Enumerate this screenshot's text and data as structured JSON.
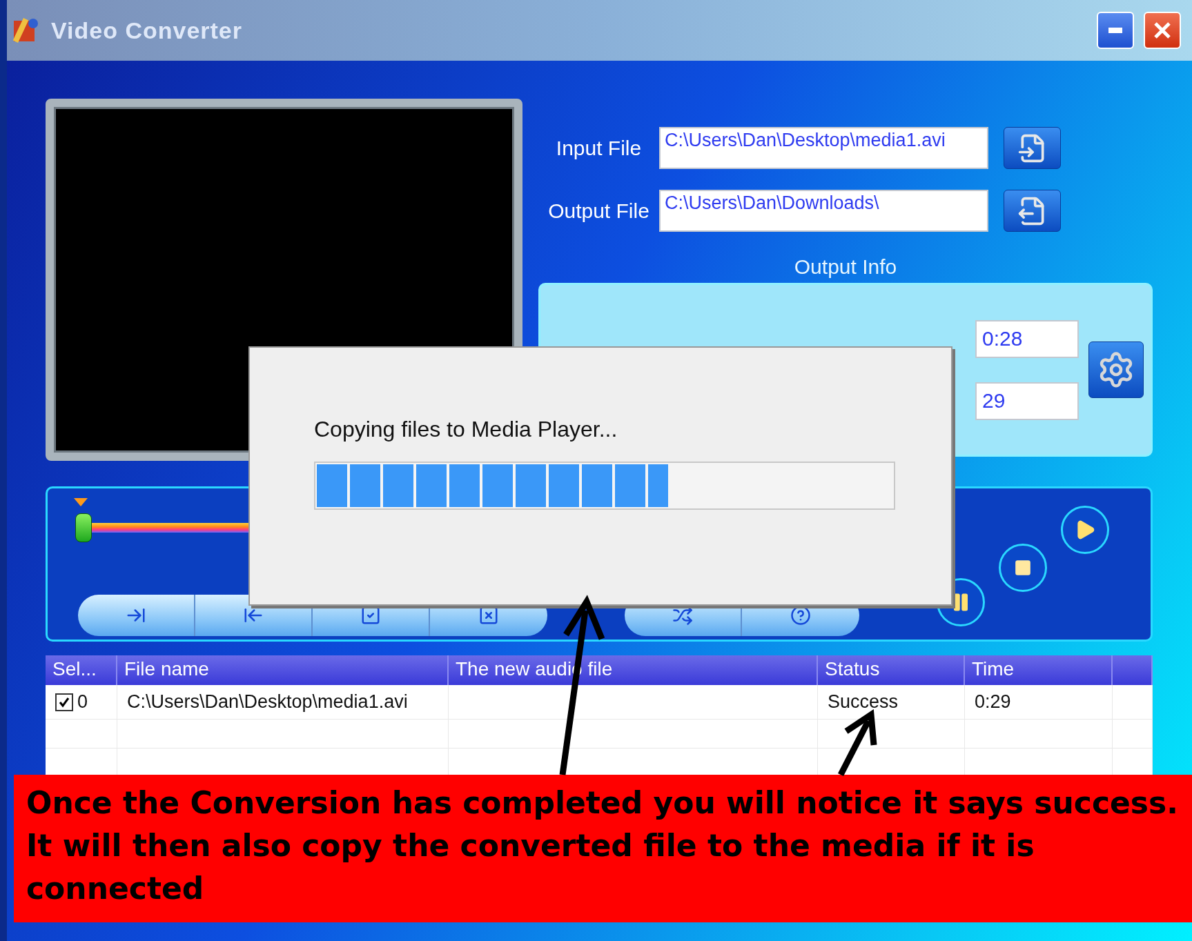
{
  "window": {
    "title": "Video Converter"
  },
  "input_file": {
    "label": "Input File",
    "value": "C:\\Users\\Dan\\Desktop\\media1.avi"
  },
  "output_file": {
    "label": "Output File",
    "value": "C:\\Users\\Dan\\Downloads\\"
  },
  "output_info": {
    "title": "Output Info",
    "fields": [
      "0:28",
      "29"
    ]
  },
  "slider": {
    "level": 0
  },
  "table": {
    "columns": [
      "Sel...",
      "File name",
      "The new audio file",
      "Status",
      "Time"
    ],
    "rows": [
      {
        "checked": true,
        "index": "0",
        "file_name": "C:\\Users\\Dan\\Desktop\\media1.avi",
        "status": "Success",
        "time": "0:29"
      }
    ]
  },
  "dialog": {
    "message": "Copying files to Media Player...",
    "level": 0.61
  },
  "annotation": {
    "text": "Once the Conversion has completed you will notice it says success. It will then also copy the converted file to the media if it is connected"
  }
}
